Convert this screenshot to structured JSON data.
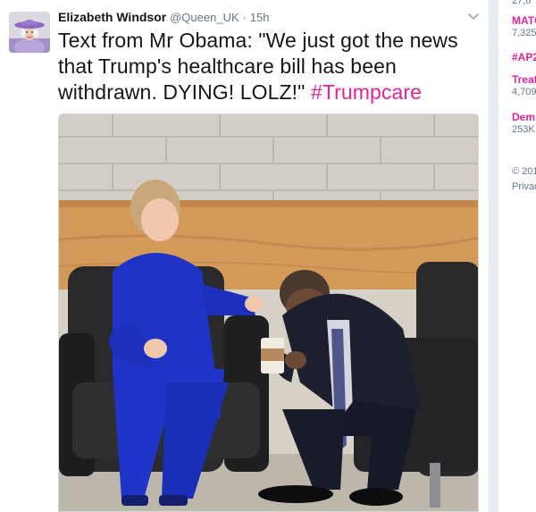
{
  "tweet": {
    "display_name": "Elizabeth Windsor",
    "screen_name": "@Queen_UK",
    "separator": "·",
    "timestamp": "15h",
    "text": "Text from Mr Obama: \"We just got the news that Trump's healthcare bill has been withdrawn. DYING! LOLZ!\"",
    "hashtag": "#Trumpcare",
    "icons": {
      "menu": "chevron-down-icon",
      "avatar": "queen-avatar"
    }
  },
  "trends": {
    "items": [
      {
        "name": "MATC",
        "count": "7,325"
      },
      {
        "name": "#AP2",
        "count": ""
      },
      {
        "name": "Treat",
        "count": "4,709"
      },
      {
        "name": "Dem",
        "count": "253K"
      }
    ],
    "top_cut_text": "27,6",
    "footer_copyright": "© 201",
    "footer_link": "Privac"
  },
  "colors": {
    "hashtag": "#e0259a",
    "trend_name": "#e0259a",
    "meta_gray": "#657786",
    "background": "#e6ecf0"
  }
}
